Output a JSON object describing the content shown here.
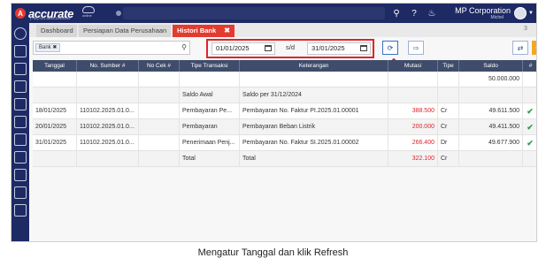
{
  "brand": {
    "name": "accurate",
    "subtitle": "(+62) 021-5695-2269/399",
    "tag": "online"
  },
  "header": {
    "company": "MP Corporation",
    "user": "Michel"
  },
  "tabs": [
    {
      "label": "Dashboard"
    },
    {
      "label": "Persiapan Data Perusahaan"
    },
    {
      "label": "Histori Bank"
    }
  ],
  "tab_count": "3",
  "filter": {
    "chip": "Bank",
    "date_from": "01/01/2025",
    "separator": "s/d",
    "date_to": "31/01/2025"
  },
  "table": {
    "columns": [
      "Tanggal",
      "No. Sumber #",
      "No Cek #",
      "Tipe Transaksi",
      "Keterangan",
      "Mutasi",
      "Tipe",
      "Saldo",
      "#"
    ],
    "rows": [
      {
        "tanggal": "",
        "sumber": "",
        "cek": "",
        "tipe_transaksi": "",
        "keterangan": "",
        "mutasi": "",
        "tipe": "",
        "saldo": "50.000.000",
        "check": ""
      },
      {
        "tanggal": "",
        "sumber": "",
        "cek": "",
        "tipe_transaksi": "Saldo Awal",
        "keterangan": "Saldo per 31/12/2024",
        "mutasi": "",
        "tipe": "",
        "saldo": "",
        "check": ""
      },
      {
        "tanggal": "18/01/2025",
        "sumber": "110102.2025.01.0...",
        "cek": "",
        "tipe_transaksi": "Pembayaran Pe...",
        "keterangan": "Pembayaran No. Faktur PI.2025.01.00001",
        "mutasi": "388.500",
        "tipe": "Cr",
        "saldo": "49.611.500",
        "check": "✔"
      },
      {
        "tanggal": "20/01/2025",
        "sumber": "110102.2025.01.0...",
        "cek": "",
        "tipe_transaksi": "Pembayaran",
        "keterangan": "Pembayaran Beban Listrik",
        "mutasi": "200.000",
        "tipe": "Cr",
        "saldo": "49.411.500",
        "check": "✔"
      },
      {
        "tanggal": "31/01/2025",
        "sumber": "110102.2025.01.0...",
        "cek": "",
        "tipe_transaksi": "Penerimaan Penj...",
        "keterangan": "Pembayaran No. Faktur SI.2025.01.00002",
        "mutasi": "266.400",
        "tipe": "Dr",
        "saldo": "49.677.900",
        "check": "✔"
      },
      {
        "tanggal": "",
        "sumber": "",
        "cek": "",
        "tipe_transaksi": "Total",
        "keterangan": "Total",
        "mutasi": "322.100",
        "tipe": "Cr",
        "saldo": "",
        "check": ""
      }
    ]
  },
  "caption": "Mengatur Tanggal dan klik Refresh",
  "colors": {
    "nav": "#1e2a64",
    "accent": "#e33b2f",
    "highlight": "#e0232b",
    "header": "#3f4c6b"
  }
}
